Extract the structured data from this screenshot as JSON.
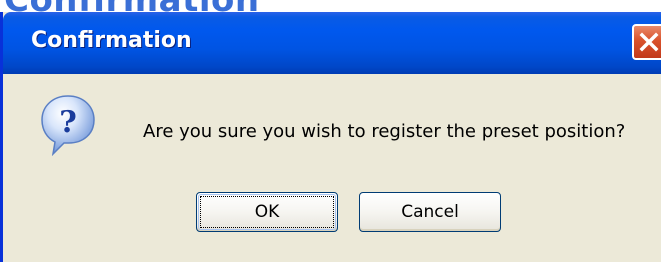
{
  "backdrop": {
    "title_fragment": "Confirmation"
  },
  "dialog": {
    "title": "Confirmation",
    "message": "Are you sure you wish to register the preset position?",
    "icon": "question-icon",
    "buttons": {
      "ok_label": "OK",
      "cancel_label": "Cancel"
    },
    "close_icon": "close-icon"
  },
  "colors": {
    "titlebar": "#0054e3",
    "dialog_bg": "#ece9d8",
    "close_button": "#d9522c",
    "backdrop_text": "#3a6fd6"
  }
}
